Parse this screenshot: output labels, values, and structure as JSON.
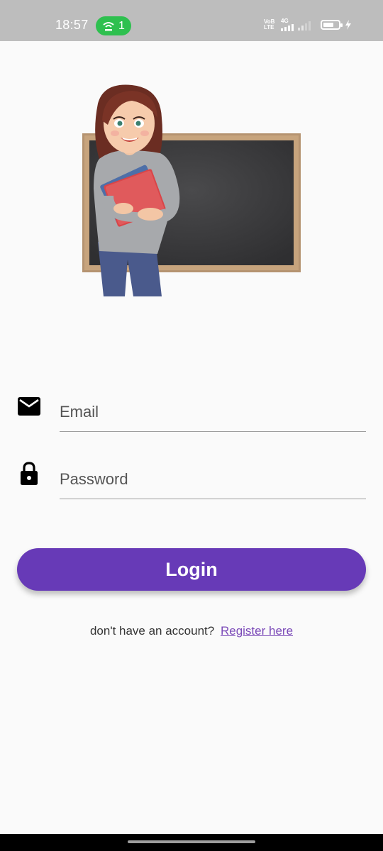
{
  "status_bar": {
    "time": "18:57",
    "hotspot_count": "1",
    "network_tag": "VoB LTE",
    "network_type": "4G",
    "battery_level": 0.7
  },
  "form": {
    "email": {
      "placeholder": "Email",
      "value": "",
      "icon": "envelope-icon"
    },
    "password": {
      "placeholder": "Password",
      "value": "",
      "icon": "lock-icon"
    }
  },
  "login_button": {
    "label": "Login",
    "color": "#673ab7"
  },
  "register": {
    "prompt": "don't have an account?",
    "link_label": "Register here",
    "link_color": "#7b4ab8"
  }
}
